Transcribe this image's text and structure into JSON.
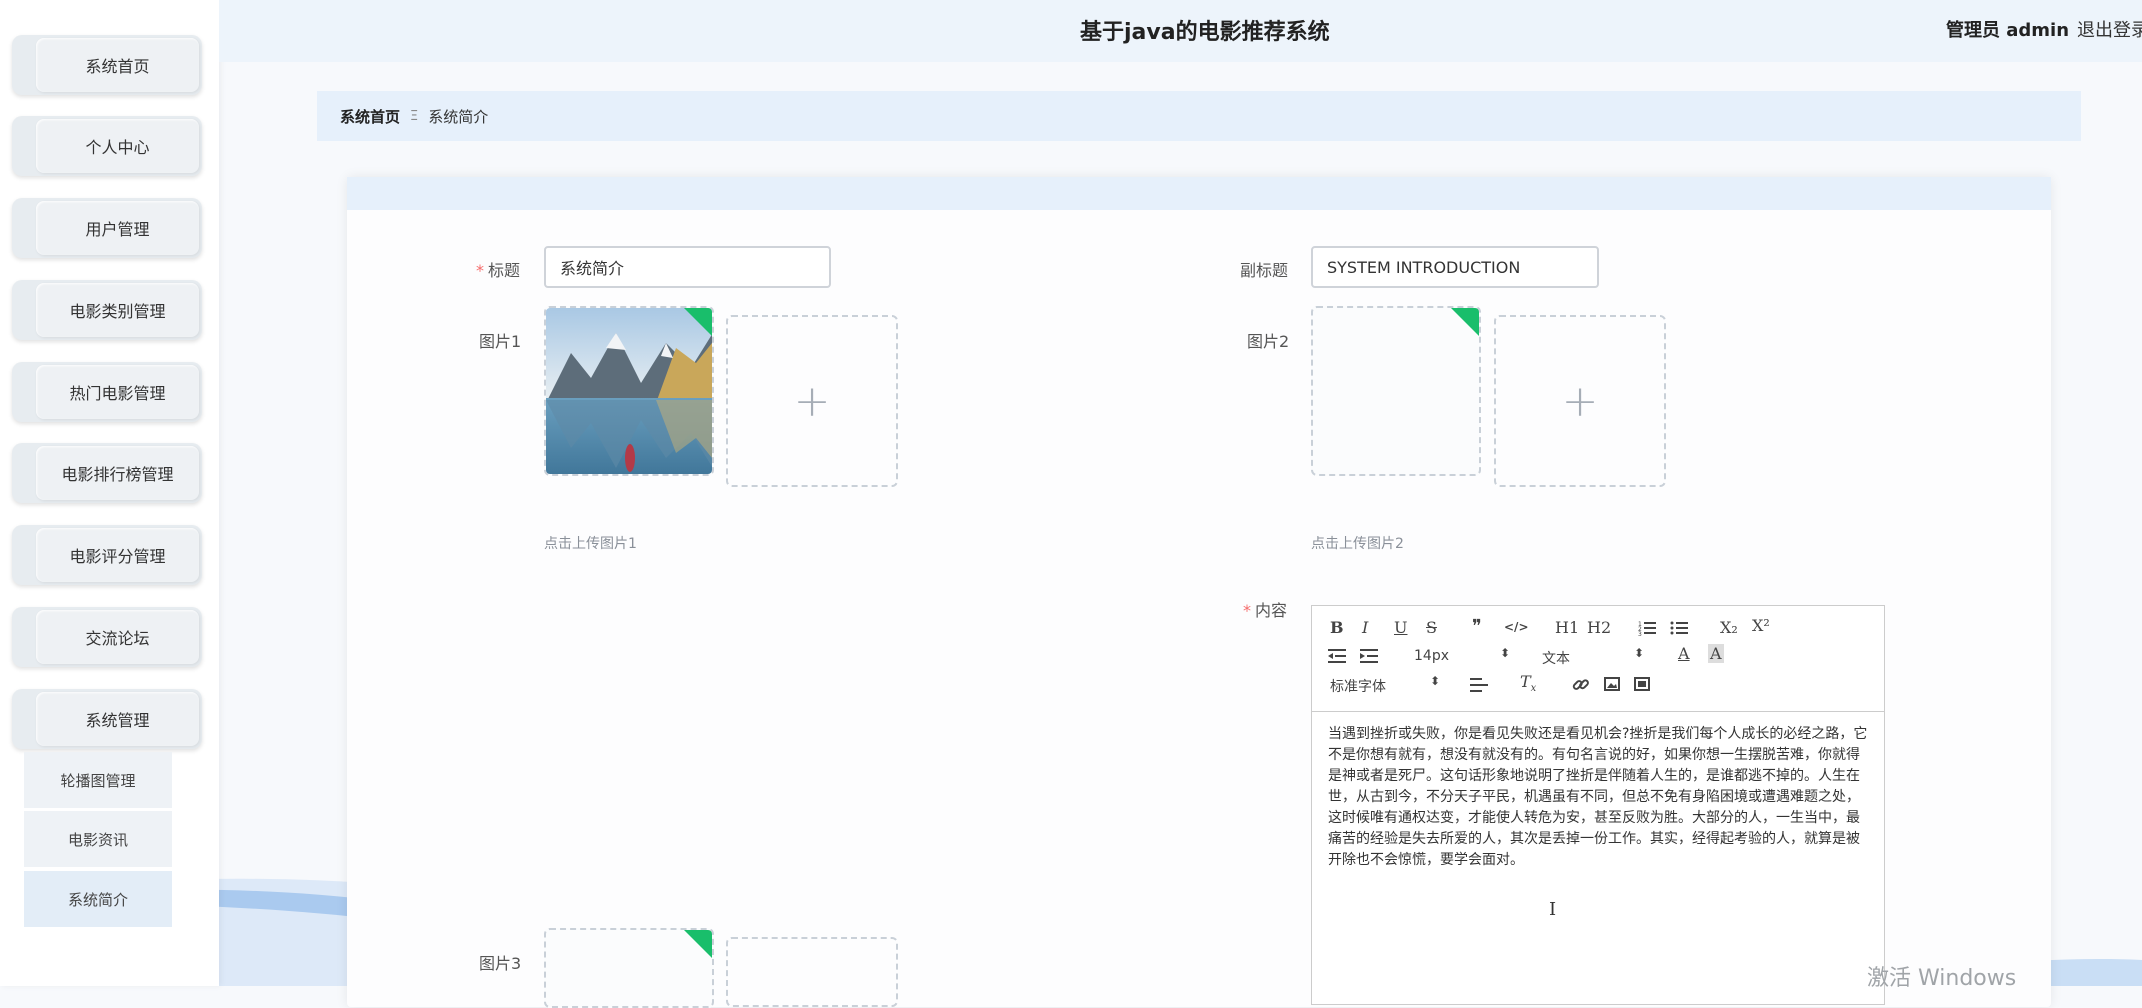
{
  "header": {
    "title": "基于java的电影推荐系统",
    "user": "管理员 admin",
    "logout": "退出登录"
  },
  "sidebar": {
    "items": [
      {
        "label": "系统首页"
      },
      {
        "label": "个人中心"
      },
      {
        "label": "用户管理"
      },
      {
        "label": "电影类别管理"
      },
      {
        "label": "热门电影管理"
      },
      {
        "label": "电影排行榜管理"
      },
      {
        "label": "电影评分管理"
      },
      {
        "label": "交流论坛"
      },
      {
        "label": "系统管理"
      }
    ],
    "subitems": [
      {
        "label": "轮播图管理"
      },
      {
        "label": "电影资讯"
      },
      {
        "label": "系统简介"
      }
    ]
  },
  "breadcrumb": {
    "home": "系统首页",
    "separator": "Ξ",
    "current": "系统简介"
  },
  "form": {
    "title_label": "标题",
    "title_value": "系统简介",
    "subtitle_label": "副标题",
    "subtitle_value": "SYSTEM INTRODUCTION",
    "image1_label": "图片1",
    "image1_hint": "点击上传图片1",
    "image2_label": "图片2",
    "image2_hint": "点击上传图片2",
    "image3_label": "图片3",
    "content_label": "内容",
    "plus": "+"
  },
  "editor": {
    "toolbar": {
      "bold": "B",
      "italic": "I",
      "underline": "U",
      "strike": "S",
      "quote": "❞",
      "code": "</>",
      "h1": "H1",
      "h2": "H2",
      "sub": "X₂",
      "sup": "X²",
      "size": "14px",
      "format": "文本",
      "font": "标准字体"
    },
    "content": "当遇到挫折或失败，你是看见失败还是看见机会?挫折是我们每个人成长的必经之路，它不是你想有就有，想没有就没有的。有句名言说的好，如果你想一生摆脱苦难，你就得是神或者是死尸。这句话形象地说明了挫折是伴随着人生的，是谁都逃不掉的。人生在世，从古到今，不分天子平民，机遇虽有不同，但总不免有身陷困境或遭遇难题之处，这时候唯有通权达变，才能使人转危为安，甚至反败为胜。大部分的人，一生当中，最痛苦的经验是失去所爱的人，其次是丢掉一份工作。其实，经得起考验的人，就算是被开除也不会惊慌，要学会面对。"
  },
  "watermark": "激活 Windows",
  "colors": {
    "accent": "#19be6b",
    "header_bg": "#edf4fb",
    "required": "#f56c6c"
  }
}
